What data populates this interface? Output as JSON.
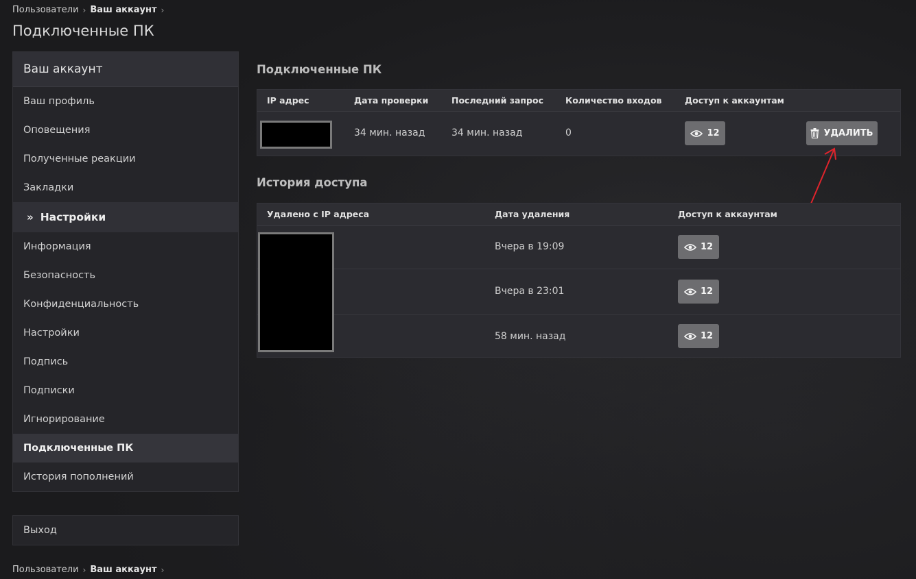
{
  "breadcrumb": {
    "items": [
      "Пользователи",
      "Ваш аккаунт"
    ]
  },
  "page_title": "Подключенные ПК",
  "sidebar": {
    "header": "Ваш аккаунт",
    "items_top": [
      "Ваш профиль",
      "Оповещения",
      "Полученные реакции",
      "Закладки"
    ],
    "section": "Настройки",
    "items_bottom": [
      "Информация",
      "Безопасность",
      "Конфиденциальность",
      "Настройки",
      "Подпись",
      "Подписки",
      "Игнорирование",
      "Подключенные ПК",
      "История пополнений"
    ],
    "active_item": "Подключенные ПК"
  },
  "logout_label": "Выход",
  "connected": {
    "title": "Подключенные ПК",
    "headers": [
      "IP адрес",
      "Дата проверки",
      "Последний запрос",
      "Количество входов",
      "Доступ к аккаунтам"
    ],
    "row": {
      "ip": "",
      "check_date": "34 мин. назад",
      "last_request": "34 мин. назад",
      "logins": "0",
      "access_count": "12"
    },
    "delete_label": "УДАЛИТЬ"
  },
  "history": {
    "title": "История доступа",
    "headers": [
      "Удалено с IP адреса",
      "Дата удаления",
      "Доступ к аккаунтам"
    ],
    "rows": [
      {
        "date": "Вчера в 19:09",
        "access_count": "12"
      },
      {
        "date": "Вчера в 23:01",
        "access_count": "12"
      },
      {
        "date": "58 мин. назад",
        "access_count": "12"
      }
    ]
  },
  "colors": {
    "annotation_arrow": "#e0242c",
    "button": "#6d6d70"
  }
}
